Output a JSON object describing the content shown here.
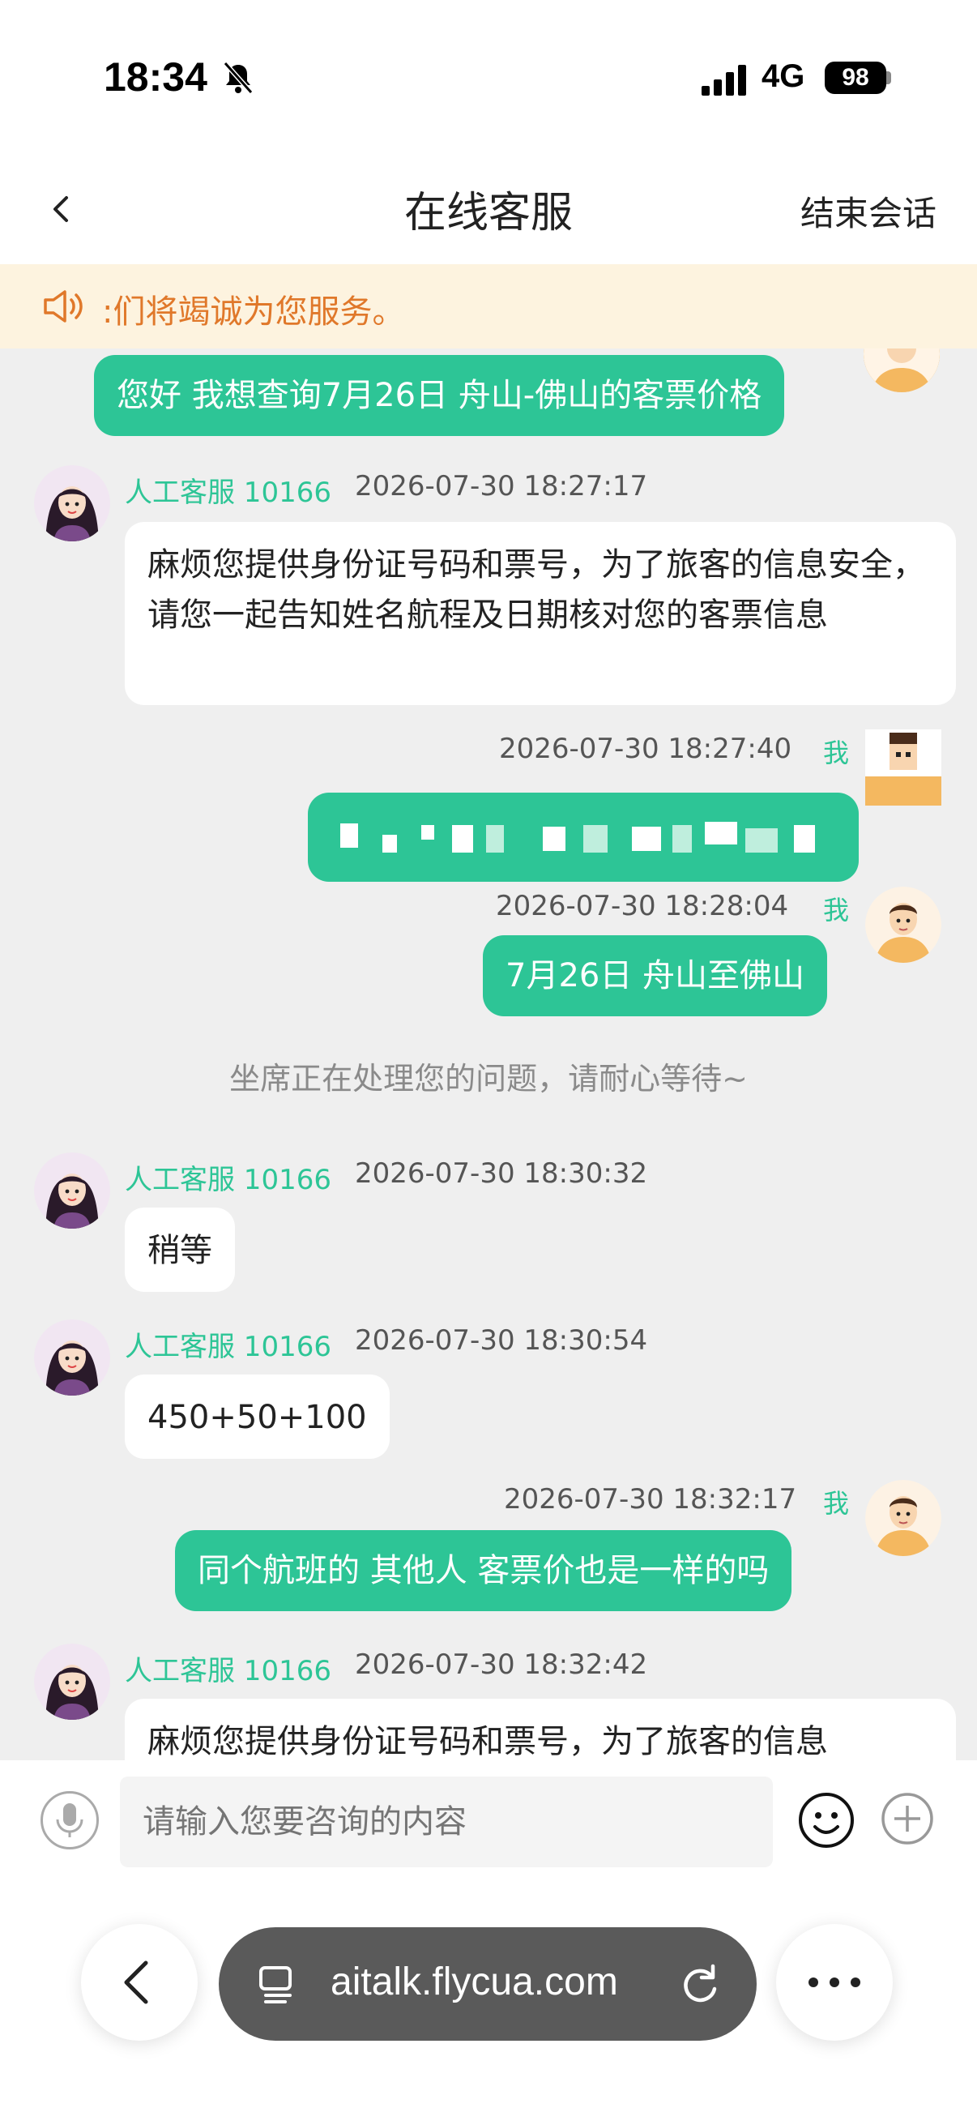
{
  "status_bar": {
    "time": "18:34",
    "network": "4G",
    "battery": "98"
  },
  "nav": {
    "title": "在线客服",
    "end_label": "结束会话"
  },
  "notice": {
    "text": ":们将竭诚为您服务。"
  },
  "messages": {
    "m1": {
      "text": "您好 我想查询7月26日 舟山-佛山的客票价格"
    },
    "m2": {
      "agent": "人工客服 10166",
      "time": "2026-07-30 18:27:17",
      "text": "麻烦您提供身份证号码和票号，为了旅客的信息安全，请您一起告知姓名航程及日期核对您的客票信息"
    },
    "m3": {
      "time": "2026-07-30 18:27:40",
      "me": "我"
    },
    "m4": {
      "time": "2026-07-30 18:28:04",
      "me": "我",
      "text": "7月26日 舟山至佛山"
    },
    "sys": {
      "text": "坐席正在处理您的问题，请耐心等待~"
    },
    "m5": {
      "agent": "人工客服 10166",
      "time": "2026-07-30 18:30:32",
      "text": "稍等"
    },
    "m6": {
      "agent": "人工客服 10166",
      "time": "2026-07-30 18:30:54",
      "text": "450+50+100"
    },
    "m7": {
      "time": "2026-07-30 18:32:17",
      "me": "我",
      "text": "同个航班的 其他人 客票价也是一样的吗"
    },
    "m8": {
      "agent": "人工客服 10166",
      "time": "2026-07-30 18:32:42",
      "text": "麻烦您提供身份证号码和票号，为了旅客的信息"
    }
  },
  "input": {
    "placeholder": "请输入您要咨询的内容"
  },
  "browser": {
    "url": "aitalk.flycua.com"
  },
  "colors": {
    "accent": "#2dc596",
    "notice_text": "#e0782a",
    "notice_bg": "#fdf3df",
    "chat_bg": "#efefef"
  },
  "icons": [
    "bell-slash-icon",
    "signal-icon",
    "back-icon",
    "speaker-icon",
    "mic-icon",
    "emoji-icon",
    "plus-icon",
    "tab-icon",
    "reload-icon",
    "more-icon"
  ]
}
